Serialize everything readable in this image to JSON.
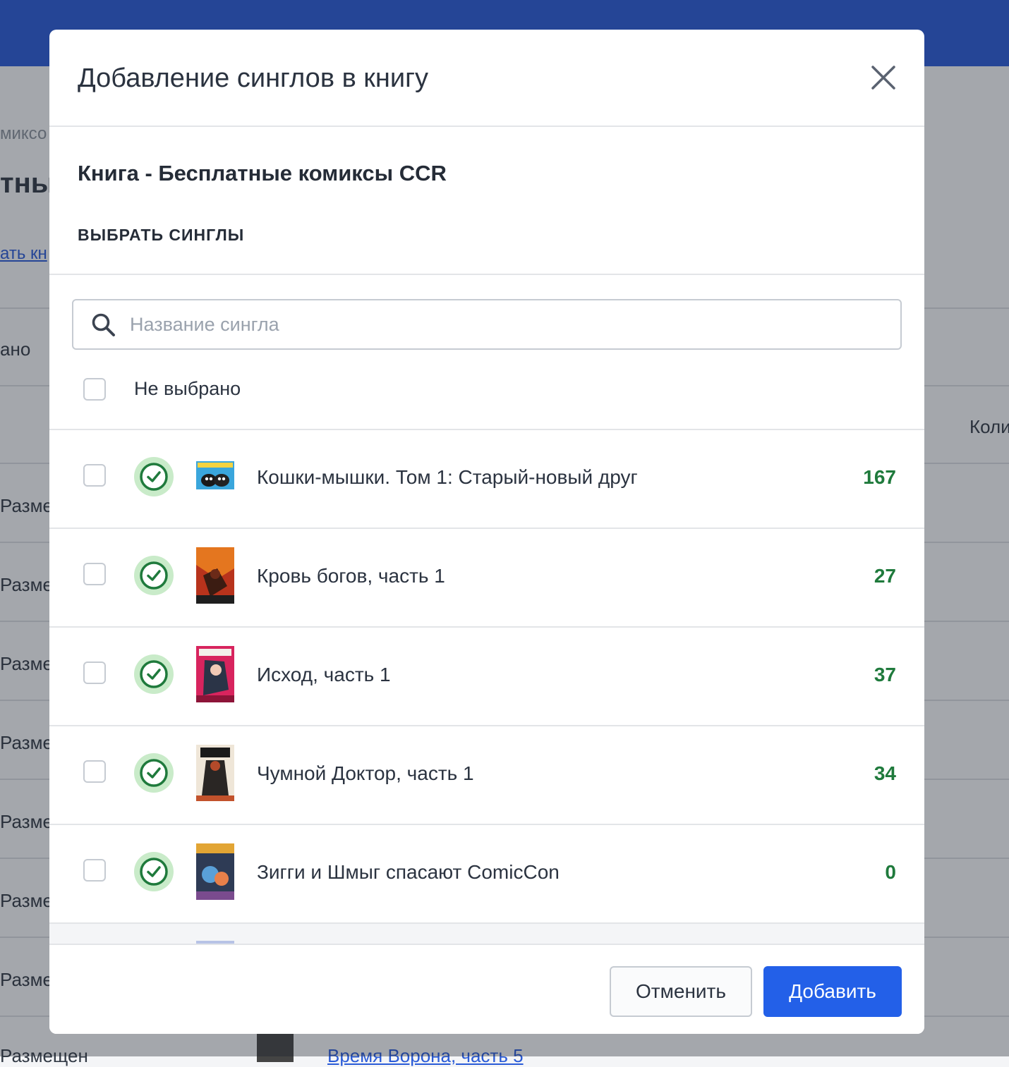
{
  "background": {
    "breadcrumb_fragment": "миксо",
    "heading_fragment": "тны",
    "link_fragment": "ать кн",
    "filter_fragment": "ано",
    "column_fragment": "Коли",
    "row_status_fragment": "Разме",
    "last_row_status": "Размещен",
    "last_row_title": "Время Ворона, часть 5"
  },
  "modal": {
    "title": "Добавление синглов в книгу",
    "book_title": "Книга - Бесплатные комиксы CCR",
    "section_label": "ВЫБРАТЬ СИНГЛЫ",
    "search": {
      "placeholder": "Название сингла"
    },
    "select_all_label": "Не выбрано",
    "items": [
      {
        "title": "Кошки-мышки. Том 1: Старый-новый друг",
        "count": "167"
      },
      {
        "title": "Кровь богов, часть 1",
        "count": "27"
      },
      {
        "title": "Исход, часть 1",
        "count": "37"
      },
      {
        "title": "Чумной Доктор, часть 1",
        "count": "34"
      },
      {
        "title": "Зигги и Шмыг спасают ComicCon",
        "count": "0"
      }
    ],
    "footer": {
      "cancel_label": "Отменить",
      "add_label": "Добавить"
    }
  },
  "colors": {
    "topbar": "#2a5bd7",
    "primary_button": "#2360e8",
    "success_green": "#1f7a3c",
    "success_ring": "#c9ebc9"
  },
  "icons": {
    "close": "close-icon",
    "search": "search-icon",
    "status": "check-circle-icon"
  }
}
